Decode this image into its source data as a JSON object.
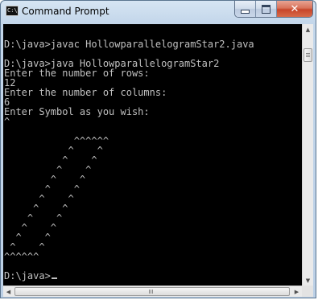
{
  "window": {
    "title": "Command Prompt",
    "app_icon": "cmd-icon",
    "app_icon_text": "C:\\",
    "controls": {
      "minimize_icon": "minimize-icon",
      "maximize_icon": "maximize-icon",
      "close_icon": "close-icon",
      "close_glyph": "✕"
    }
  },
  "console": {
    "lines": [
      "",
      "D:\\java>javac HollowparallelogramStar2.java",
      "",
      "D:\\java>java HollowparallelogramStar2",
      "Enter the number of rows:",
      "12",
      "Enter the number of columns:",
      "6",
      "Enter Symbol as you wish:",
      "^",
      "",
      "            ^^^^^^",
      "           ^    ^",
      "          ^    ^",
      "         ^    ^",
      "        ^    ^",
      "       ^    ^",
      "      ^    ^",
      "     ^    ^",
      "    ^    ^",
      "   ^    ^",
      "  ^    ^",
      " ^    ^",
      "^^^^^^",
      "",
      "D:\\java>"
    ],
    "cursor": "blinking-underscore"
  },
  "scrollbars": {
    "up_arrow": "▲",
    "down_arrow": "▼",
    "left_arrow": "◀",
    "right_arrow": "▶"
  },
  "colors": {
    "console_bg": "#000000",
    "console_fg": "#c0c0c0",
    "frame": "#bcd0e6",
    "close_button": "#c7452a"
  }
}
